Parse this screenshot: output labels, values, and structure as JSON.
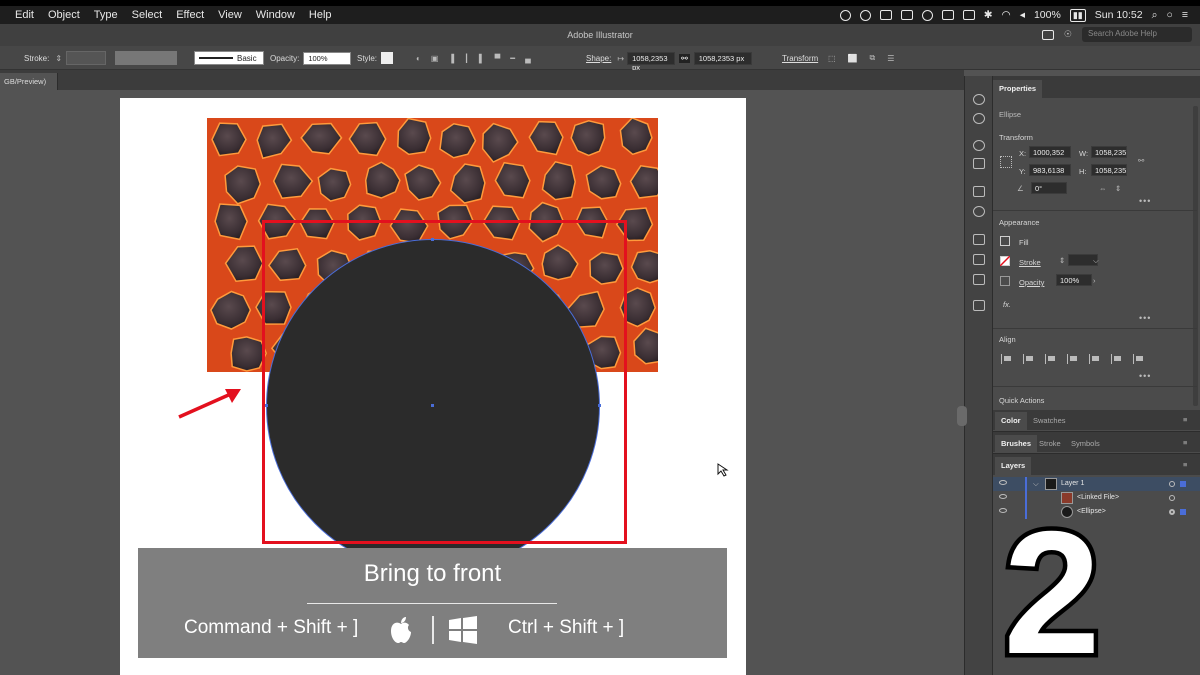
{
  "menubar": {
    "items": [
      "Edit",
      "Object",
      "Type",
      "Select",
      "Effect",
      "View",
      "Window",
      "Help"
    ],
    "battery": "100%",
    "clock": "Sun 10:52"
  },
  "titlebar": {
    "app_title": "Adobe Illustrator",
    "search_placeholder": "Search Adobe Help"
  },
  "controlbar": {
    "stroke_label": "Stroke:",
    "brush_label": "Basic",
    "opacity_label": "Opacity:",
    "opacity_value": "100%",
    "style_label": "Style:",
    "shape_label": "Shape:",
    "shape_width": "1058,2353 px",
    "shape_height": "1058,2353 px",
    "transform_label": "Transform"
  },
  "document": {
    "tab_label": "GB/Preview)"
  },
  "caption": {
    "title": "Bring to front",
    "mac_shortcut": "Command + Shift + ]",
    "win_shortcut": "Ctrl + Shift + ]"
  },
  "properties": {
    "tab_label": "Properties",
    "object_type": "Ellipse",
    "transform": {
      "heading": "Transform",
      "x_label": "X:",
      "x_value": "1000,352",
      "y_label": "Y:",
      "y_value": "983,6138",
      "w_label": "W:",
      "w_value": "1058,235",
      "h_label": "H:",
      "h_value": "1058,235",
      "rotate_value": "0°"
    },
    "appearance": {
      "heading": "Appearance",
      "fill_label": "Fill",
      "stroke_label": "Stroke",
      "opacity_label": "Opacity",
      "opacity_value": "100%",
      "fx_label": "fx."
    },
    "align": {
      "heading": "Align"
    },
    "quick_actions": {
      "heading": "Quick Actions"
    }
  },
  "panel_tabs": {
    "color_group": [
      "Color",
      "Swatches"
    ],
    "brush_group": [
      "Brushes",
      "Stroke",
      "Symbols"
    ],
    "layers_tab": "Layers"
  },
  "layers": [
    {
      "name": "Layer 1"
    },
    {
      "name": "<Linked File>"
    },
    {
      "name": "<Ellipse>"
    }
  ],
  "overlay": {
    "step_number": "2"
  },
  "colors": {
    "highlight_red": "#e3101e",
    "selection_blue": "#4a6dd8",
    "ellipse_fill": "#2b2b2b"
  }
}
